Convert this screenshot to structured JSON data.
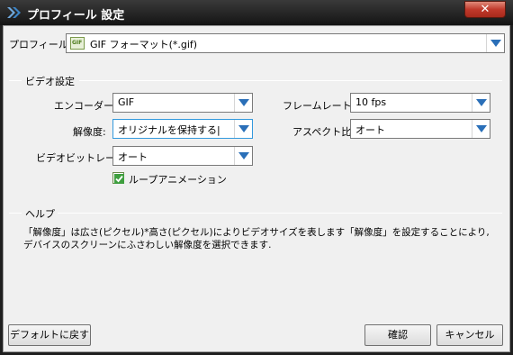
{
  "window": {
    "title": "プロフィール 設定",
    "close_label": "✕",
    "accent_color": "#c0392b"
  },
  "profile": {
    "label": "プロフィール:",
    "value": "GIF フォーマット(*.gif)",
    "icon_text": "GIF"
  },
  "video": {
    "section_title": "ビデオ設定",
    "encoder": {
      "label": "エンコーダー:",
      "value": "GIF"
    },
    "framerate": {
      "label": "フレームレート:",
      "value": "10 fps"
    },
    "resolution": {
      "label": "解像度:",
      "value": "オリジナルを保持する|"
    },
    "aspect": {
      "label": "アスペクト比:",
      "value": "オート"
    },
    "bitrate": {
      "label": "ビデオビットレート:",
      "value": "オート"
    },
    "loop": {
      "label": "ループアニメーション",
      "checked": true
    }
  },
  "help": {
    "section_title": "ヘルプ",
    "text": "「解像度」は広さ(ピクセル)*高さ(ピクセル)によりビデオサイズを表します「解像度」を設定することにより,デバイスのスクリーンにふさわしい解像度を選択できます."
  },
  "buttons": {
    "reset": "デフォルトに戻す",
    "ok": "確認",
    "cancel": "キャンセル"
  }
}
